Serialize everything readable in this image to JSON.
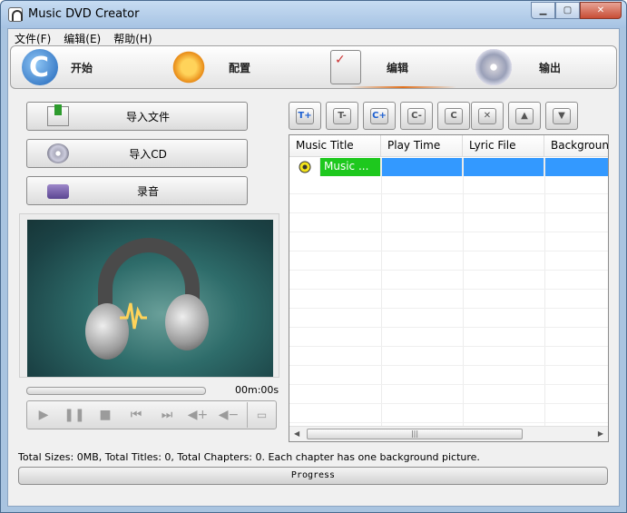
{
  "window": {
    "title": "Music DVD Creator",
    "controls": [
      "minimize",
      "maximize",
      "close"
    ]
  },
  "menu": {
    "items": [
      "文件(F)",
      "编辑(E)",
      "帮助(H)"
    ]
  },
  "steps": [
    {
      "label": "开始",
      "icon": "refresh-c-icon"
    },
    {
      "label": "配置",
      "icon": "gears-icon"
    },
    {
      "label": "编辑",
      "icon": "checklist-pencil-icon",
      "active": true
    },
    {
      "label": "输出",
      "icon": "disc-icon"
    }
  ],
  "left_buttons": [
    {
      "label": "导入文件",
      "icon": "import-file-icon"
    },
    {
      "label": "导入CD",
      "icon": "import-cd-icon"
    },
    {
      "label": "录音",
      "icon": "cassette-icon"
    }
  ],
  "player": {
    "time": "00m:00s",
    "controls": [
      "play-icon",
      "pause-icon",
      "stop-icon",
      "previous-icon",
      "next-icon",
      "volume-up-icon",
      "volume-down-icon",
      "fullscreen-icon"
    ]
  },
  "title_toolbar": {
    "buttons": [
      {
        "glyph": "T+",
        "icon": "add-title-icon"
      },
      {
        "glyph": "T-",
        "icon": "remove-title-icon"
      },
      {
        "glyph": "C+",
        "icon": "add-chapter-icon"
      },
      {
        "glyph": "C-",
        "icon": "remove-chapter-icon"
      },
      {
        "glyph": "C",
        "icon": "chapter-settings-icon"
      },
      {
        "glyph": "✕",
        "icon": "delete-icon"
      },
      {
        "glyph": "▲",
        "icon": "move-up-icon"
      },
      {
        "glyph": "▼",
        "icon": "move-down-icon"
      }
    ]
  },
  "list": {
    "columns": [
      "Music Title",
      "Play Time",
      "Lyric File",
      "Backgroun"
    ],
    "rows": [
      {
        "title": "Music ...",
        "play_time": "",
        "lyric_file": "",
        "background": "",
        "selected": true
      }
    ]
  },
  "status": {
    "text": "Total Sizes: 0MB, Total Titles: 0, Total Chapters: 0. Each chapter has one background picture.",
    "progress_label": "Progress",
    "progress": 0
  },
  "colors": {
    "selection": "#3399ff",
    "title_cell": "#1ec81e",
    "active_step_underline": "#e0701c"
  }
}
